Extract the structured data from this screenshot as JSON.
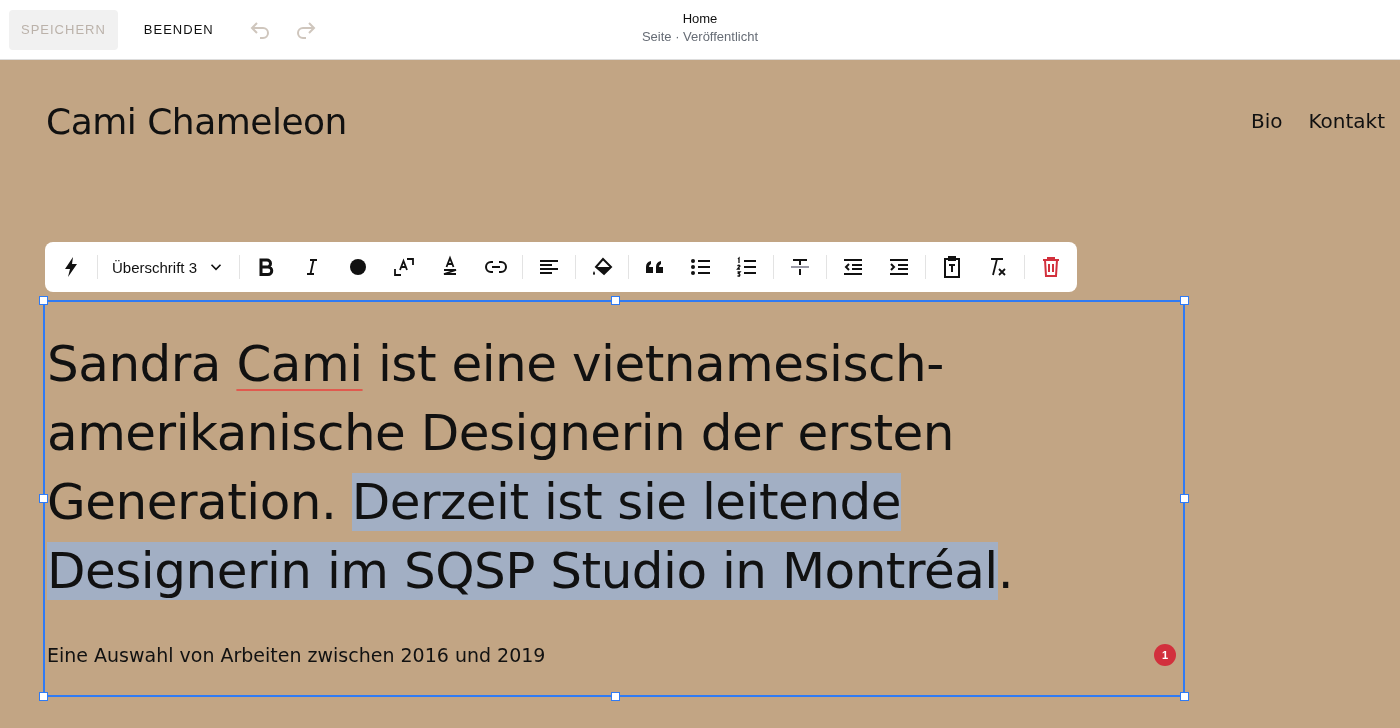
{
  "top_bar": {
    "save_button": {
      "label": "SPEICHERN",
      "disabled": true
    },
    "exit_button": {
      "label": "BEENDEN"
    },
    "undo_disabled": true,
    "redo_disabled": true,
    "page_title": "Home",
    "page_status": "Seite · Veröffentlicht"
  },
  "site": {
    "title": "Cami Chameleon",
    "nav": [
      {
        "label": "Bio"
      },
      {
        "label": "Kontakt"
      }
    ]
  },
  "toolbar": {
    "style_dropdown": "Überschrift 3"
  },
  "block": {
    "heading": [
      {
        "text": "Sandra ",
        "selected": false,
        "misspelled": false
      },
      {
        "text": "Cami",
        "selected": false,
        "misspelled": true
      },
      {
        "text": " ist eine vietnamesisch-amerikanische Designerin der ersten Generation. ",
        "selected": false,
        "misspelled": false
      },
      {
        "text": "Derzeit ist sie leitende Designerin im SQSP Studio in Montréal",
        "selected": true,
        "misspelled": false
      },
      {
        "text": ".",
        "selected": false,
        "misspelled": false
      }
    ],
    "caption": "Eine Auswahl von Arbeiten zwischen 2016 und 2019",
    "badge": "1"
  }
}
